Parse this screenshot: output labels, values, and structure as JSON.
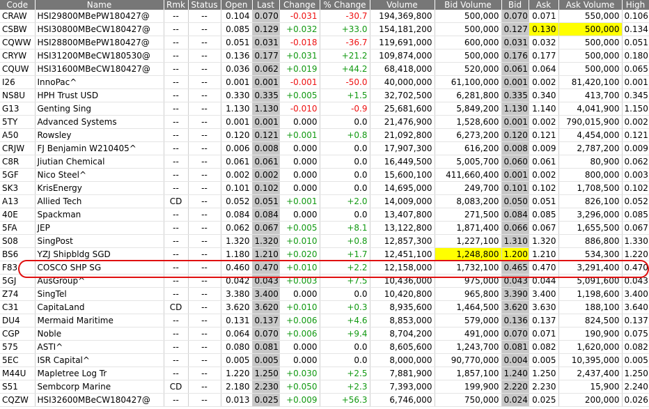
{
  "columns": [
    {
      "key": "code",
      "label": "Code",
      "w": 50
    },
    {
      "key": "name",
      "label": "Name",
      "w": 185
    },
    {
      "key": "rmk",
      "label": "Rmk",
      "w": 35
    },
    {
      "key": "status",
      "label": "Status",
      "w": 47
    },
    {
      "key": "open",
      "label": "Open",
      "w": 45
    },
    {
      "key": "last",
      "label": "Last",
      "w": 39
    },
    {
      "key": "change",
      "label": "Change",
      "w": 58
    },
    {
      "key": "pchange",
      "label": "% Change",
      "w": 72
    },
    {
      "key": "volume",
      "label": "Volume",
      "w": 93
    },
    {
      "key": "bidvol",
      "label": "Bid Volume",
      "w": 96
    },
    {
      "key": "bid",
      "label": "Bid",
      "w": 39
    },
    {
      "key": "ask",
      "label": "Ask",
      "w": 43
    },
    {
      "key": "askvol",
      "label": "Ask Volume",
      "w": 91
    },
    {
      "key": "high",
      "label": "High",
      "w": 39
    }
  ],
  "rows": [
    {
      "code": "CRAW",
      "name": "HSI29800MBePW180427@",
      "rmk": "--",
      "status": "--",
      "open": "0.104",
      "last": "0.070",
      "change": "-0.031",
      "pchange": "-30.7",
      "volume": "194,369,800",
      "bidvol": "500,000",
      "bid": "0.070",
      "ask": "0.071",
      "askvol": "550,000",
      "high": "0.106"
    },
    {
      "code": "CSBW",
      "name": "HSI30800MBeCW180427@",
      "rmk": "--",
      "status": "--",
      "open": "0.085",
      "last": "0.129",
      "change": "+0.032",
      "pchange": "+33.0",
      "volume": "154,181,200",
      "bidvol": "500,000",
      "bid": "0.127",
      "ask": "0.130",
      "askvol": "500,000",
      "high": "0.134",
      "hl": [
        "ask",
        "askvol"
      ]
    },
    {
      "code": "CQWW",
      "name": "HSI28800MBePW180427@",
      "rmk": "--",
      "status": "--",
      "open": "0.051",
      "last": "0.031",
      "change": "-0.018",
      "pchange": "-36.7",
      "volume": "119,691,000",
      "bidvol": "600,000",
      "bid": "0.031",
      "ask": "0.032",
      "askvol": "500,000",
      "high": "0.051"
    },
    {
      "code": "CRYW",
      "name": "HSI31200MBeCW180530@",
      "rmk": "--",
      "status": "--",
      "open": "0.136",
      "last": "0.177",
      "change": "+0.031",
      "pchange": "+21.2",
      "volume": "109,874,000",
      "bidvol": "500,000",
      "bid": "0.176",
      "ask": "0.177",
      "askvol": "500,000",
      "high": "0.180"
    },
    {
      "code": "CQUW",
      "name": "HSI31600MBeCW180427@",
      "rmk": "--",
      "status": "--",
      "open": "0.036",
      "last": "0.062",
      "change": "+0.019",
      "pchange": "+44.2",
      "volume": "68,418,000",
      "bidvol": "520,000",
      "bid": "0.061",
      "ask": "0.064",
      "askvol": "500,000",
      "high": "0.065"
    },
    {
      "code": "I26",
      "name": "InnoPac^",
      "rmk": "--",
      "status": "--",
      "open": "0.001",
      "last": "0.001",
      "change": "-0.001",
      "pchange": "-50.0",
      "volume": "40,000,000",
      "bidvol": "61,100,000",
      "bid": "0.001",
      "ask": "0.002",
      "askvol": "81,420,100",
      "high": "0.001"
    },
    {
      "code": "NS8U",
      "name": "HPH Trust USD",
      "rmk": "--",
      "status": "--",
      "open": "0.330",
      "last": "0.335",
      "change": "+0.005",
      "pchange": "+1.5",
      "volume": "32,702,500",
      "bidvol": "6,281,800",
      "bid": "0.335",
      "ask": "0.340",
      "askvol": "413,700",
      "high": "0.345"
    },
    {
      "code": "G13",
      "name": "Genting Sing",
      "rmk": "--",
      "status": "--",
      "open": "1.130",
      "last": "1.130",
      "change": "-0.010",
      "pchange": "-0.9",
      "volume": "25,681,600",
      "bidvol": "5,849,200",
      "bid": "1.130",
      "ask": "1.140",
      "askvol": "4,041,900",
      "high": "1.150"
    },
    {
      "code": "5TY",
      "name": "Advanced Systems",
      "rmk": "--",
      "status": "--",
      "open": "0.001",
      "last": "0.001",
      "change": "0.000",
      "pchange": "0.0",
      "volume": "21,476,900",
      "bidvol": "1,528,600",
      "bid": "0.001",
      "ask": "0.002",
      "askvol": "790,015,900",
      "high": "0.002"
    },
    {
      "code": "A50",
      "name": "Rowsley",
      "rmk": "--",
      "status": "--",
      "open": "0.120",
      "last": "0.121",
      "change": "+0.001",
      "pchange": "+0.8",
      "volume": "21,092,800",
      "bidvol": "6,273,200",
      "bid": "0.120",
      "ask": "0.121",
      "askvol": "4,454,000",
      "high": "0.121"
    },
    {
      "code": "CRJW",
      "name": "FJ Benjamin W210405^",
      "rmk": "--",
      "status": "--",
      "open": "0.006",
      "last": "0.008",
      "change": "0.000",
      "pchange": "0.0",
      "volume": "17,907,300",
      "bidvol": "616,200",
      "bid": "0.008",
      "ask": "0.009",
      "askvol": "2,787,200",
      "high": "0.009"
    },
    {
      "code": "C8R",
      "name": "Jiutian Chemical",
      "rmk": "--",
      "status": "--",
      "open": "0.061",
      "last": "0.061",
      "change": "0.000",
      "pchange": "0.0",
      "volume": "16,449,500",
      "bidvol": "5,005,700",
      "bid": "0.060",
      "ask": "0.061",
      "askvol": "80,900",
      "high": "0.062"
    },
    {
      "code": "5GF",
      "name": "Nico Steel^",
      "rmk": "--",
      "status": "--",
      "open": "0.002",
      "last": "0.002",
      "change": "0.000",
      "pchange": "0.0",
      "volume": "15,600,100",
      "bidvol": "411,660,400",
      "bid": "0.001",
      "ask": "0.002",
      "askvol": "800,000",
      "high": "0.003"
    },
    {
      "code": "SK3",
      "name": "KrisEnergy",
      "rmk": "--",
      "status": "--",
      "open": "0.101",
      "last": "0.102",
      "change": "0.000",
      "pchange": "0.0",
      "volume": "14,695,000",
      "bidvol": "249,700",
      "bid": "0.101",
      "ask": "0.102",
      "askvol": "1,708,500",
      "high": "0.102"
    },
    {
      "code": "A13",
      "name": "Allied Tech",
      "rmk": "CD",
      "status": "--",
      "open": "0.052",
      "last": "0.051",
      "change": "+0.001",
      "pchange": "+2.0",
      "volume": "14,009,000",
      "bidvol": "8,083,200",
      "bid": "0.050",
      "ask": "0.051",
      "askvol": "826,100",
      "high": "0.052"
    },
    {
      "code": "40E",
      "name": "Spackman",
      "rmk": "--",
      "status": "--",
      "open": "0.084",
      "last": "0.084",
      "change": "0.000",
      "pchange": "0.0",
      "volume": "13,407,800",
      "bidvol": "271,500",
      "bid": "0.084",
      "ask": "0.085",
      "askvol": "3,296,000",
      "high": "0.085"
    },
    {
      "code": "5FA",
      "name": "JEP",
      "rmk": "--",
      "status": "--",
      "open": "0.062",
      "last": "0.067",
      "change": "+0.005",
      "pchange": "+8.1",
      "volume": "13,122,800",
      "bidvol": "1,871,400",
      "bid": "0.066",
      "ask": "0.067",
      "askvol": "1,655,500",
      "high": "0.067"
    },
    {
      "code": "S08",
      "name": "SingPost",
      "rmk": "--",
      "status": "--",
      "open": "1.320",
      "last": "1.320",
      "change": "+0.010",
      "pchange": "+0.8",
      "volume": "12,857,300",
      "bidvol": "1,227,100",
      "bid": "1.310",
      "ask": "1.320",
      "askvol": "886,800",
      "high": "1.330"
    },
    {
      "code": "BS6",
      "name": "YZJ Shipbldg SGD",
      "rmk": "--",
      "status": "--",
      "open": "1.180",
      "last": "1.210",
      "change": "+0.020",
      "pchange": "+1.7",
      "volume": "12,451,100",
      "bidvol": "1,248,800",
      "bid": "1.200",
      "ask": "1.210",
      "askvol": "534,300",
      "high": "1.220",
      "hl": [
        "bidvol",
        "bid"
      ]
    },
    {
      "code": "F83",
      "name": "COSCO SHP SG",
      "rmk": "--",
      "status": "--",
      "open": "0.460",
      "last": "0.470",
      "change": "+0.010",
      "pchange": "+2.2",
      "volume": "12,158,000",
      "bidvol": "1,732,100",
      "bid": "0.465",
      "ask": "0.470",
      "askvol": "3,291,400",
      "high": "0.470"
    },
    {
      "code": "5GJ",
      "name": "AusGroup^",
      "rmk": "--",
      "status": "--",
      "open": "0.042",
      "last": "0.043",
      "change": "+0.003",
      "pchange": "+7.5",
      "volume": "10,436,000",
      "bidvol": "975,000",
      "bid": "0.043",
      "ask": "0.044",
      "askvol": "5,091,600",
      "high": "0.043"
    },
    {
      "code": "Z74",
      "name": "SingTel",
      "rmk": "--",
      "status": "--",
      "open": "3.380",
      "last": "3.400",
      "change": "0.000",
      "pchange": "0.0",
      "volume": "10,420,800",
      "bidvol": "965,800",
      "bid": "3.390",
      "ask": "3.400",
      "askvol": "1,198,600",
      "high": "3.400"
    },
    {
      "code": "C31",
      "name": "CapitaLand",
      "rmk": "CD",
      "status": "--",
      "open": "3.620",
      "last": "3.620",
      "change": "+0.010",
      "pchange": "+0.3",
      "volume": "8,935,600",
      "bidvol": "1,464,500",
      "bid": "3.620",
      "ask": "3.630",
      "askvol": "188,100",
      "high": "3.640"
    },
    {
      "code": "DU4",
      "name": "Mermaid Maritime",
      "rmk": "--",
      "status": "--",
      "open": "0.131",
      "last": "0.137",
      "change": "+0.006",
      "pchange": "+4.6",
      "volume": "8,853,000",
      "bidvol": "579,000",
      "bid": "0.136",
      "ask": "0.137",
      "askvol": "824,500",
      "high": "0.137"
    },
    {
      "code": "CGP",
      "name": "Noble",
      "rmk": "--",
      "status": "--",
      "open": "0.064",
      "last": "0.070",
      "change": "+0.006",
      "pchange": "+9.4",
      "volume": "8,704,200",
      "bidvol": "491,000",
      "bid": "0.070",
      "ask": "0.071",
      "askvol": "190,900",
      "high": "0.075"
    },
    {
      "code": "575",
      "name": "ASTI^",
      "rmk": "--",
      "status": "--",
      "open": "0.080",
      "last": "0.081",
      "change": "0.000",
      "pchange": "0.0",
      "volume": "8,605,600",
      "bidvol": "1,243,700",
      "bid": "0.081",
      "ask": "0.082",
      "askvol": "1,620,000",
      "high": "0.082"
    },
    {
      "code": "5EC",
      "name": "ISR Capital^",
      "rmk": "--",
      "status": "--",
      "open": "0.005",
      "last": "0.005",
      "change": "0.000",
      "pchange": "0.0",
      "volume": "8,000,000",
      "bidvol": "90,770,000",
      "bid": "0.004",
      "ask": "0.005",
      "askvol": "10,395,000",
      "high": "0.005"
    },
    {
      "code": "M44U",
      "name": "Mapletree Log Tr",
      "rmk": "--",
      "status": "--",
      "open": "1.220",
      "last": "1.250",
      "change": "+0.030",
      "pchange": "+2.5",
      "volume": "7,881,900",
      "bidvol": "1,857,100",
      "bid": "1.240",
      "ask": "1.250",
      "askvol": "2,437,400",
      "high": "1.250"
    },
    {
      "code": "S51",
      "name": "Sembcorp Marine",
      "rmk": "CD",
      "status": "--",
      "open": "2.180",
      "last": "2.230",
      "change": "+0.050",
      "pchange": "+2.3",
      "volume": "7,393,000",
      "bidvol": "199,900",
      "bid": "2.220",
      "ask": "2.230",
      "askvol": "15,900",
      "high": "2.240"
    },
    {
      "code": "CQZW",
      "name": "HSI32600MBeCW180427@",
      "rmk": "--",
      "status": "--",
      "open": "0.013",
      "last": "0.025",
      "change": "+0.009",
      "pchange": "+56.3",
      "volume": "6,746,000",
      "bidvol": "750,000",
      "bid": "0.024",
      "ask": "0.025",
      "askvol": "200,000",
      "high": "0.026"
    }
  ],
  "selected_row": 19,
  "colors": {
    "header_bg": "#777777",
    "shade": "#c8c8c8",
    "highlight": "#ffff00",
    "positive": "#119911",
    "negative": "#ee1111",
    "selection": "#e01010"
  }
}
